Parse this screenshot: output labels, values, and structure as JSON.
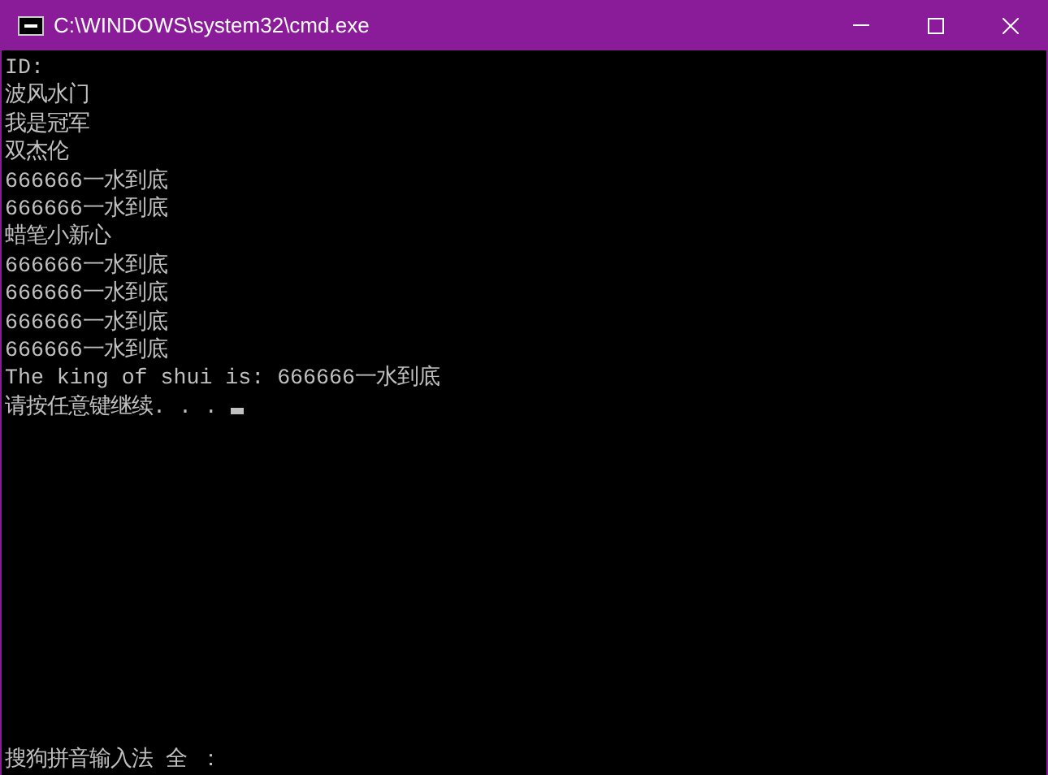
{
  "window": {
    "title": "C:\\WINDOWS\\system32\\cmd.exe"
  },
  "console": {
    "lines": [
      "ID:",
      "波风水门",
      "我是冠军",
      "双杰伦",
      "666666一水到底",
      "666666一水到底",
      "蜡笔小新心",
      "666666一水到底",
      "666666一水到底",
      "666666一水到底",
      "666666一水到底",
      "The king of shui is: 666666一水到底"
    ],
    "prompt": "请按任意键继续. . . "
  },
  "ime_status": "搜狗拼音输入法 全 ："
}
